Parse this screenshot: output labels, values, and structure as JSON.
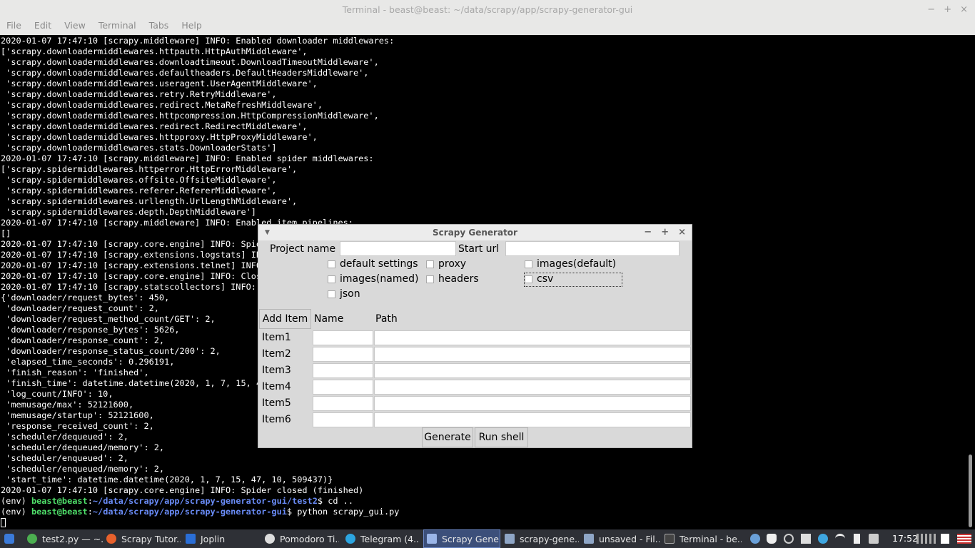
{
  "terminal": {
    "title": "Terminal - beast@beast: ~/data/scrapy/app/scrapy-generator-gui",
    "controls": [
      "−",
      "+",
      "×"
    ],
    "menu": [
      "File",
      "Edit",
      "View",
      "Terminal",
      "Tabs",
      "Help"
    ],
    "lines": [
      "2020-01-07 17:47:10 [scrapy.middleware] INFO: Enabled downloader middlewares:",
      "['scrapy.downloadermiddlewares.httpauth.HttpAuthMiddleware',",
      " 'scrapy.downloadermiddlewares.downloadtimeout.DownloadTimeoutMiddleware',",
      " 'scrapy.downloadermiddlewares.defaultheaders.DefaultHeadersMiddleware',",
      " 'scrapy.downloadermiddlewares.useragent.UserAgentMiddleware',",
      " 'scrapy.downloadermiddlewares.retry.RetryMiddleware',",
      " 'scrapy.downloadermiddlewares.redirect.MetaRefreshMiddleware',",
      " 'scrapy.downloadermiddlewares.httpcompression.HttpCompressionMiddleware',",
      " 'scrapy.downloadermiddlewares.redirect.RedirectMiddleware',",
      " 'scrapy.downloadermiddlewares.httpproxy.HttpProxyMiddleware',",
      " 'scrapy.downloadermiddlewares.stats.DownloaderStats']",
      "2020-01-07 17:47:10 [scrapy.middleware] INFO: Enabled spider middlewares:",
      "['scrapy.spidermiddlewares.httperror.HttpErrorMiddleware',",
      " 'scrapy.spidermiddlewares.offsite.OffsiteMiddleware',",
      " 'scrapy.spidermiddlewares.referer.RefererMiddleware',",
      " 'scrapy.spidermiddlewares.urllength.UrlLengthMiddleware',",
      " 'scrapy.spidermiddlewares.depth.DepthMiddleware']",
      "2020-01-07 17:47:10 [scrapy.middleware] INFO: Enabled item pipelines:",
      "[]",
      "2020-01-07 17:47:10 [scrapy.core.engine] INFO: Spide",
      "2020-01-07 17:47:10 [scrapy.extensions.logstats] INF",
      "2020-01-07 17:47:10 [scrapy.extensions.telnet] INFO",
      "2020-01-07 17:47:10 [scrapy.core.engine] INFO: Clos",
      "2020-01-07 17:47:10 [scrapy.statscollectors] INFO: D",
      "{'downloader/request_bytes': 450,",
      " 'downloader/request_count': 2,",
      " 'downloader/request_method_count/GET': 2,",
      " 'downloader/response_bytes': 5626,",
      " 'downloader/response_count': 2,",
      " 'downloader/response_status_count/200': 2,",
      " 'elapsed_time_seconds': 0.296191,",
      " 'finish_reason': 'finished',",
      " 'finish_time': datetime.datetime(2020, 1, 7, 15, 47",
      " 'log_count/INFO': 10,",
      " 'memusage/max': 52121600,",
      " 'memusage/startup': 52121600,",
      " 'response_received_count': 2,",
      " 'scheduler/dequeued': 2,",
      " 'scheduler/dequeued/memory': 2,",
      " 'scheduler/enqueued': 2,",
      " 'scheduler/enqueued/memory': 2,",
      " 'start_time': datetime.datetime(2020, 1, 7, 15, 47, 10, 509437)}",
      "2020-01-07 17:47:10 [scrapy.core.engine] INFO: Spider closed (finished)"
    ],
    "prompt1": {
      "env": "(env) ",
      "user": "beast@beast",
      "sep": ":",
      "path": "~/data/scrapy/app/scrapy-generator-gui/test2",
      "cmd": "$ cd .."
    },
    "prompt2": {
      "env": "(env) ",
      "user": "beast@beast",
      "sep": ":",
      "path": "~/data/scrapy/app/scrapy-generator-gui",
      "cmd": "$ python scrapy_gui.py"
    }
  },
  "dialog": {
    "title": "Scrapy Generator",
    "menu_glyph": "▼",
    "controls": [
      "−",
      "+",
      "×"
    ],
    "project_name_label": "Project name",
    "project_name_value": "",
    "start_url_label": "Start url",
    "start_url_value": "",
    "options": {
      "default_settings": "default settings",
      "proxy": "proxy",
      "images_default": "images(default)",
      "images_named": "images(named)",
      "headers": "headers",
      "csv": "csv",
      "json": "json"
    },
    "add_item_label": "Add Item",
    "name_header": "Name",
    "path_header": "Path",
    "items": [
      "Item1",
      "Item2",
      "Item3",
      "Item4",
      "Item5",
      "Item6"
    ],
    "generate_label": "Generate",
    "run_shell_label": "Run shell"
  },
  "taskbar": {
    "items": [
      "test2.py — ~...",
      "Scrapy Tutor...",
      "Joplin",
      "Pomodoro Ti...",
      "Telegram (4...",
      "Scrapy Gene...",
      "scrapy-gene...",
      "unsaved - Fil...",
      "Terminal - be..."
    ],
    "clock": "17:52",
    "colors": {
      "bar": "#2e3036",
      "active": "#3c4f7a"
    }
  }
}
